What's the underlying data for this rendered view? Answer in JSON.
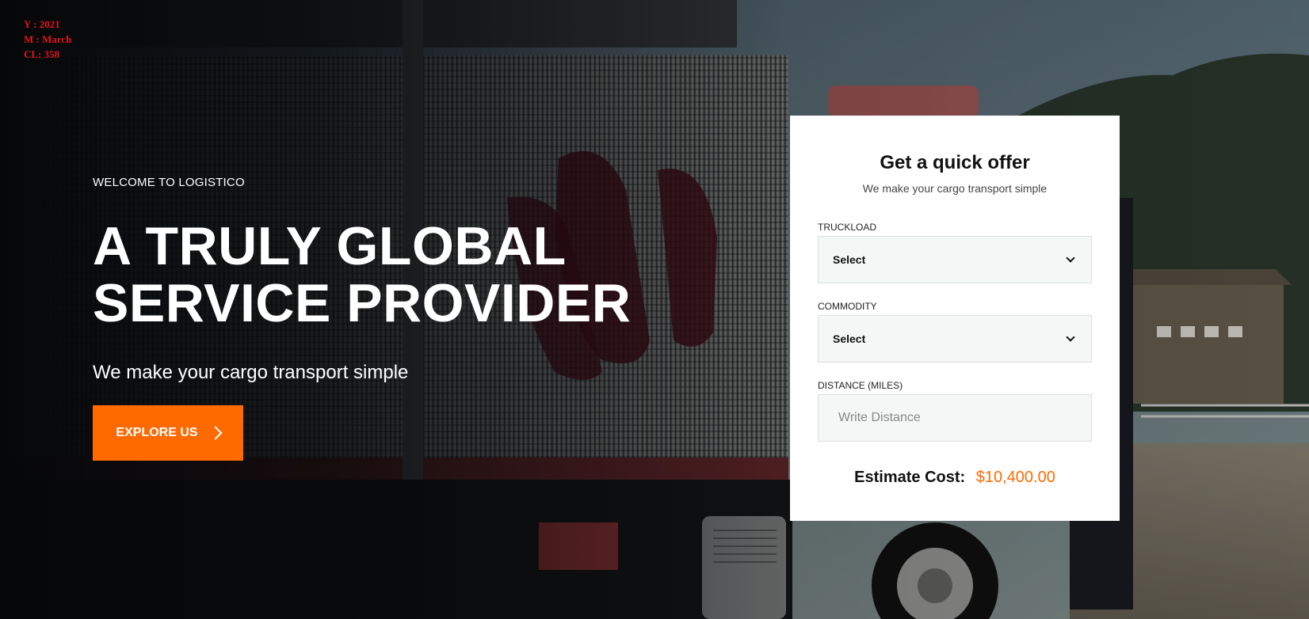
{
  "stamp": {
    "year": "Y : 2021",
    "month": "M : March",
    "cl": "CL: 358"
  },
  "hero": {
    "eyebrow": "WELCOME TO LOGISTICO",
    "headline_line1": "A TRULY GLOBAL",
    "headline_line2": "SERVICE PROVIDER",
    "subline": "We make your cargo transport simple",
    "cta_label": "EXPLORE US",
    "cta_icon": "chevron-right-icon"
  },
  "quote": {
    "title": "Get a quick offer",
    "subtitle": "We make your cargo transport simple",
    "truckload": {
      "label": "TRUCKLOAD",
      "value": "Select"
    },
    "commodity": {
      "label": "COMMODITY",
      "value": "Select"
    },
    "distance": {
      "label": "DISTANCE (MILES)",
      "placeholder": "Write Distance"
    },
    "estimate_label": "Estimate Cost:",
    "estimate_value": "$10,400.00"
  },
  "colors": {
    "accent": "#ff6a00",
    "stamp": "#e3141b",
    "card_bg": "#ffffff",
    "field_bg": "#f5f6f6"
  }
}
